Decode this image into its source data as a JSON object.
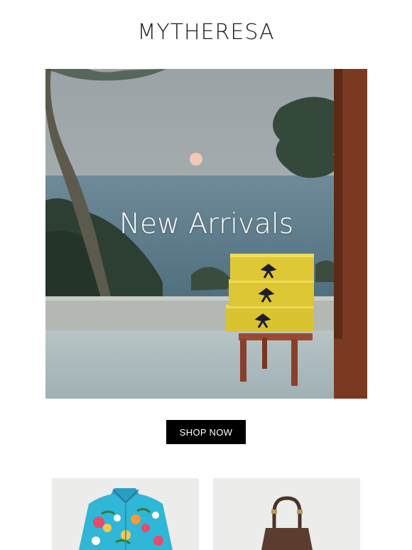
{
  "brand": {
    "logo_text": "MYTHERESA"
  },
  "hero": {
    "title": "New Arrivals"
  },
  "cta": {
    "label": "SHOP NOW"
  },
  "products": [
    {
      "icon": "floral-shirt-image"
    },
    {
      "icon": "leather-bag-image"
    }
  ]
}
